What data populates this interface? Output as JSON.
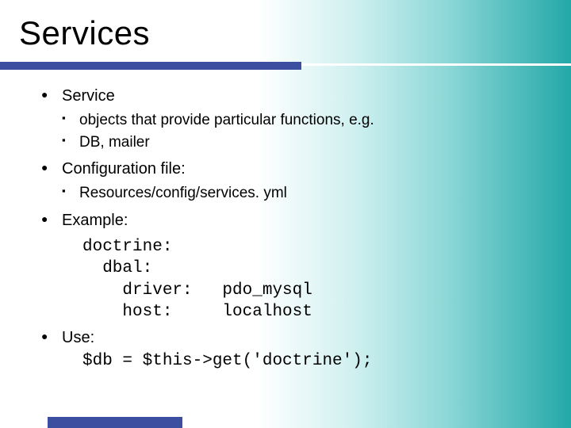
{
  "title": "Services",
  "bullets": [
    {
      "label": "Service",
      "sub": [
        "objects that provide particular functions, e.g.",
        "DB, mailer"
      ]
    },
    {
      "label": "Configuration file:",
      "sub": [
        "Resources/config/services. yml"
      ]
    },
    {
      "label": "Example:",
      "code": "doctrine:\n  dbal:\n    driver:   pdo_mysql\n    host:     localhost"
    },
    {
      "label": "Use:",
      "code_inline": "$db = $this->get('doctrine');"
    }
  ]
}
